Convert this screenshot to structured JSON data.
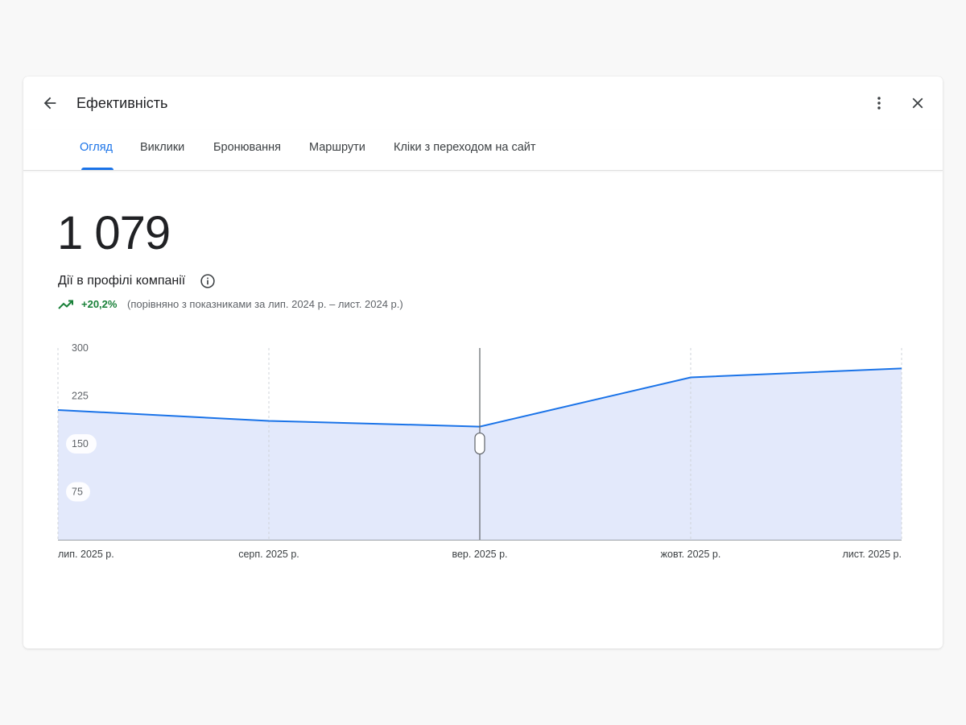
{
  "header": {
    "title": "Ефективність",
    "back_icon": "arrow-back-icon",
    "more_icon": "more-vert-icon",
    "close_icon": "close-icon"
  },
  "tabs": [
    {
      "label": "Огляд",
      "active": true
    },
    {
      "label": "Виклики",
      "active": false
    },
    {
      "label": "Бронювання",
      "active": false
    },
    {
      "label": "Маршрути",
      "active": false
    },
    {
      "label": "Кліки з переходом на сайт",
      "active": false
    }
  ],
  "summary": {
    "total": "1 079",
    "label": "Дії в профілі компанії",
    "info_icon": "info-icon",
    "trend_icon": "trending-up-icon",
    "change": "+20,2%",
    "comparison": "(порівняно з показниками за лип. 2024 р. – лист. 2024 р.)"
  },
  "colors": {
    "accent": "#1a73e8",
    "area_fill": "#e3e9fb",
    "positive": "#188038"
  },
  "chart_data": {
    "type": "area",
    "categories": [
      "лип. 2025 р.",
      "серп. 2025 р.",
      "вер. 2025 р.",
      "жовт. 2025 р.",
      "лист. 2025 р."
    ],
    "values": [
      203,
      186,
      177,
      254,
      268
    ],
    "y_ticks": [
      "300",
      "225",
      "150",
      "75"
    ],
    "ylim": [
      0,
      300
    ],
    "grid": "vertical dashed",
    "cursor_category": "вер. 2025 р."
  }
}
